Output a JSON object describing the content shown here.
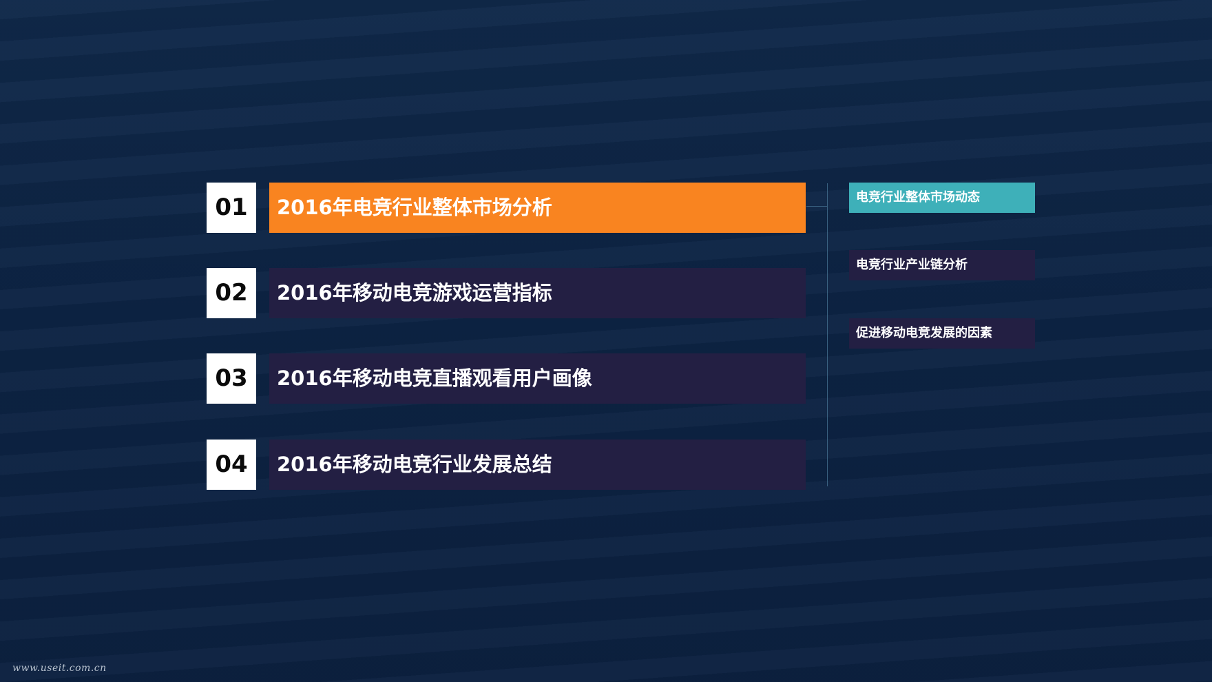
{
  "agenda": [
    {
      "number": "01",
      "title": "2016年电竞行业整体市场分析"
    },
    {
      "number": "02",
      "title": "2016年移动电竞游戏运营指标"
    },
    {
      "number": "03",
      "title": "2016年移动电竞直播观看用户画像"
    },
    {
      "number": "04",
      "title": "2016年移动电竞行业发展总结"
    }
  ],
  "subtopics": [
    {
      "label": "电竞行业整体市场动态"
    },
    {
      "label": "电竞行业产业链分析"
    },
    {
      "label": "促进移动电竞发展的因素"
    }
  ],
  "footer": {
    "url": "www.useit.com.cn"
  },
  "colors": {
    "background": "#0e2545",
    "active_bar": "#f98420",
    "inactive_bar": "#231f43",
    "active_subtopic": "#3eb0b9",
    "number_box": "#ffffff"
  }
}
